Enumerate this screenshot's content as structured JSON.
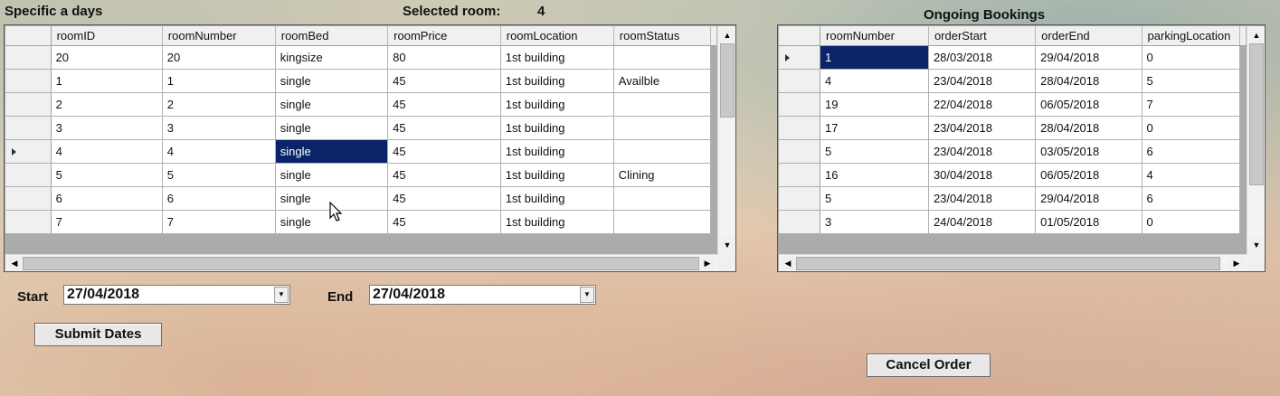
{
  "left": {
    "title": "Specific a days",
    "selected_label": "Selected room:",
    "selected_value": "4",
    "columns": [
      "roomID",
      "roomNumber",
      "roomBed",
      "roomPrice",
      "roomLocation",
      "roomStatus"
    ],
    "rows": [
      [
        "20",
        "20",
        "kingsize",
        "80",
        "1st building",
        ""
      ],
      [
        "1",
        "1",
        "single",
        "45",
        "1st building",
        "Availble"
      ],
      [
        "2",
        "2",
        "single",
        "45",
        "1st building",
        ""
      ],
      [
        "3",
        "3",
        "single",
        "45",
        "1st building",
        ""
      ],
      [
        "4",
        "4",
        "single",
        "45",
        "1st building",
        ""
      ],
      [
        "5",
        "5",
        "single",
        "45",
        "1st building",
        "Clining"
      ],
      [
        "6",
        "6",
        "single",
        "45",
        "1st building",
        ""
      ],
      [
        "7",
        "7",
        "single",
        "45",
        "1st building",
        ""
      ]
    ],
    "current_row": 4,
    "selected_cell": [
      4,
      2
    ]
  },
  "right": {
    "title": "Ongoing Bookings",
    "columns": [
      "roomNumber",
      "orderStart",
      "orderEnd",
      "parkingLocation"
    ],
    "rows": [
      [
        "1",
        "28/03/2018",
        "29/04/2018",
        "0"
      ],
      [
        "4",
        "23/04/2018",
        "28/04/2018",
        "5"
      ],
      [
        "19",
        "22/04/2018",
        "06/05/2018",
        "7"
      ],
      [
        "17",
        "23/04/2018",
        "28/04/2018",
        "0"
      ],
      [
        "5",
        "23/04/2018",
        "03/05/2018",
        "6"
      ],
      [
        "16",
        "30/04/2018",
        "06/05/2018",
        "4"
      ],
      [
        "5",
        "23/04/2018",
        "29/04/2018",
        "6"
      ],
      [
        "3",
        "24/04/2018",
        "01/05/2018",
        "0"
      ]
    ],
    "current_row": 0,
    "selected_cell": [
      0,
      0
    ]
  },
  "dates": {
    "start_label": "Start",
    "start_value": "27/04/2018",
    "end_label": "End",
    "end_value": "27/04/2018"
  },
  "buttons": {
    "submit": "Submit Dates",
    "cancel": "Cancel Order"
  },
  "colors": {
    "selection": "#0a246a",
    "grid_background": "#ababab"
  }
}
